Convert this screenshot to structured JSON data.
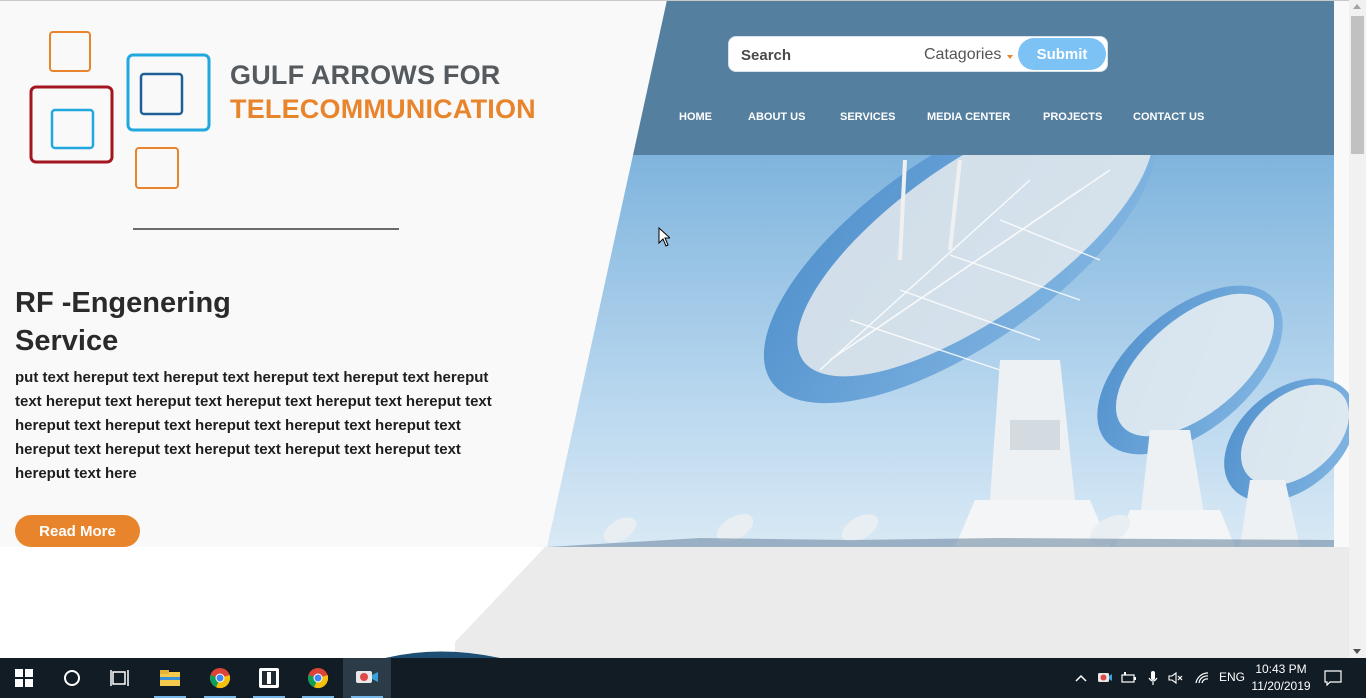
{
  "logo": {
    "line1": "GULF ARROWS FOR",
    "line2": "TELECOMMUNICATION"
  },
  "search": {
    "placeholder": "Search",
    "category_label": "Catagories",
    "submit_label": "Submit"
  },
  "nav": {
    "items": [
      "HOME",
      "ABOUT US",
      "SERVICES",
      "MEDIA CENTER",
      "PROJECTS",
      "CONTACT US"
    ]
  },
  "hero": {
    "title_line1": "RF -Engenering",
    "title_line2": "Service",
    "body": "put text hereput text hereput text hereput text hereput text hereput text hereput text hereput text hereput text hereput text hereput text hereput text hereput text hereput text hereput text hereput text hereput text hereput text hereput text hereput text hereput text hereput text here",
    "read_more_label": "Read More"
  },
  "colors": {
    "brand_orange": "#e8852c",
    "header_blue": "#557f9f",
    "submit_blue": "#7cc2f5",
    "logo_red": "#a3161f",
    "logo_cyan": "#21a8df",
    "logo_dark_blue": "#1f5f98"
  },
  "taskbar": {
    "icons": [
      "windows-start-icon",
      "cortana-search-icon",
      "task-view-icon",
      "file-explorer-icon",
      "chrome-icon",
      "app-icon",
      "chrome-icon",
      "screen-recorder-icon"
    ],
    "tray_icons": [
      "chevron-up-icon",
      "recorder-tray-icon",
      "battery-icon",
      "microphone-icon",
      "volume-muted-icon",
      "wifi-icon",
      "notification-icon"
    ],
    "language": "ENG",
    "time": "10:43 PM",
    "date": "11/20/2019"
  }
}
